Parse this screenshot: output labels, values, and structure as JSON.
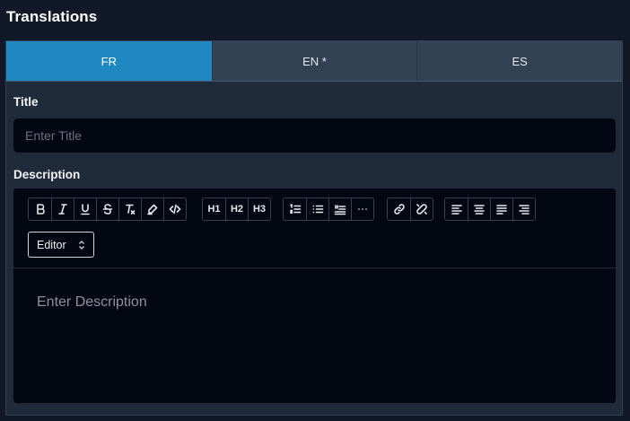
{
  "section": {
    "title": "Translations"
  },
  "tabs": [
    {
      "label": "FR",
      "active": true
    },
    {
      "label": "EN *",
      "active": false
    },
    {
      "label": "ES",
      "active": false
    }
  ],
  "title_field": {
    "label": "Title",
    "placeholder": "Enter Title",
    "value": ""
  },
  "description_field": {
    "label": "Description",
    "placeholder": "Enter Description"
  },
  "toolbar": {
    "heading_labels": [
      "H1",
      "H2",
      "H3"
    ],
    "mode_select": {
      "value": "Editor"
    },
    "icons": {
      "format": [
        "bold-icon",
        "italic-icon",
        "underline-icon",
        "strikethrough-icon",
        "clear-format-icon",
        "highlight-icon",
        "code-icon"
      ],
      "headings": [
        "heading-1-icon",
        "heading-2-icon",
        "heading-3-icon"
      ],
      "lists": [
        "ordered-list-icon",
        "bullet-list-icon",
        "blockquote-icon",
        "more-icon"
      ],
      "links": [
        "link-icon",
        "unlink-icon"
      ],
      "align": [
        "align-left-icon",
        "align-center-icon",
        "align-justify-icon",
        "align-right-icon"
      ]
    }
  },
  "colors": {
    "background": "#111827",
    "card": "#1f2a3b",
    "active_tab": "#1f88c0",
    "inactive_tab": "#334155",
    "input": "#030712"
  }
}
